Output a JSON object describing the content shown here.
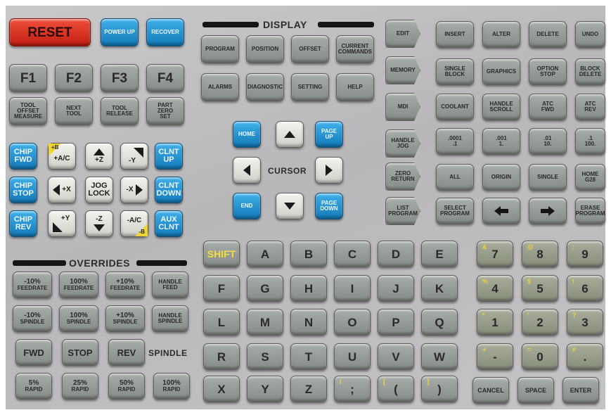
{
  "top_keys": {
    "reset": "RESET",
    "power_up": "POWER UP",
    "recover": "RECOVER"
  },
  "function_keys": [
    "F1",
    "F2",
    "F3",
    "F4"
  ],
  "tool_keys": [
    [
      "TOOL",
      "OFFSET",
      "MEASURE"
    ],
    [
      "NEXT",
      "TOOL"
    ],
    [
      "TOOL",
      "RELEASE"
    ],
    [
      "PART",
      "ZERO",
      "SET"
    ]
  ],
  "jog": {
    "chip_fwd": [
      "CHIP",
      "FWD"
    ],
    "chip_stop": [
      "CHIP",
      "STOP"
    ],
    "chip_rev": [
      "CHIP",
      "REV"
    ],
    "clnt_up": [
      "CLNT",
      "UP"
    ],
    "clnt_down": [
      "CLNT",
      "DOWN"
    ],
    "aux_clnt": [
      "AUX",
      "CLNT"
    ],
    "plus_b": "+B",
    "plus_ac": "+A/C",
    "plus_z": "+Z",
    "minus_y": "-Y",
    "plus_x": "+X",
    "jog_lock": [
      "JOG",
      "LOCK"
    ],
    "minus_x": "-X",
    "plus_y": "+Y",
    "minus_z": "-Z",
    "minus_ac": "-A/C",
    "minus_b": "-B"
  },
  "overrides": {
    "title": "OVERRIDES",
    "feed": [
      [
        "-10%",
        "FEEDRATE"
      ],
      [
        "100%",
        "FEEDRATE"
      ],
      [
        "+10%",
        "FEEDRATE"
      ],
      [
        "HANDLE",
        "FEED"
      ]
    ],
    "spindle": [
      [
        "-10%",
        "SPINDLE"
      ],
      [
        "100%",
        "SPINDLE"
      ],
      [
        "+10%",
        "SPINDLE"
      ],
      [
        "HANDLE",
        "SPINDLE"
      ]
    ],
    "spindle_ctrl": [
      "FWD",
      "STOP",
      "REV"
    ],
    "spindle_label": "SPINDLE",
    "rapid": [
      [
        "5%",
        "RAPID"
      ],
      [
        "25%",
        "RAPID"
      ],
      [
        "50%",
        "RAPID"
      ],
      [
        "100%",
        "RAPID"
      ]
    ]
  },
  "display": {
    "title": "DISPLAY",
    "row1": [
      [
        "PROGRAM"
      ],
      [
        "POSITION"
      ],
      [
        "OFFSET"
      ],
      [
        "CURRENT",
        "COMMANDS"
      ]
    ],
    "row2": [
      [
        "ALARMS"
      ],
      [
        "DIAGNOSTIC"
      ],
      [
        "SETTING"
      ],
      [
        "HELP"
      ]
    ]
  },
  "cursor": {
    "label": "CURSOR",
    "home": "HOME",
    "page_up": [
      "PAGE",
      "UP"
    ],
    "end": "END",
    "page_down": [
      "PAGE",
      "DOWN"
    ]
  },
  "modes": [
    [
      "EDIT"
    ],
    [
      "MEMORY"
    ],
    [
      "MDI"
    ],
    [
      "HANDLE",
      "JOG"
    ],
    [
      "ZERO",
      "RETURN"
    ],
    [
      "LIST",
      "PROGRAM"
    ]
  ],
  "right_keys": [
    [
      [
        "INSERT"
      ],
      [
        "ALTER"
      ],
      [
        "DELETE"
      ],
      [
        "UNDO"
      ]
    ],
    [
      [
        "SINGLE",
        "BLOCK"
      ],
      [
        "GRAPHICS"
      ],
      [
        "OPTION",
        "STOP"
      ],
      [
        "BLOCK",
        "DELETE"
      ]
    ],
    [
      [
        "COOLANT"
      ],
      [
        "HANDLE",
        "SCROLL"
      ],
      [
        "ATC",
        "FWD"
      ],
      [
        "ATC",
        "REV"
      ]
    ],
    [
      [
        ".0001",
        ".1"
      ],
      [
        ".001",
        "1."
      ],
      [
        ".01",
        "10."
      ],
      [
        ".1",
        "100."
      ]
    ],
    [
      [
        "ALL"
      ],
      [
        "ORIGIN"
      ],
      [
        "SINGLE"
      ],
      [
        "HOME",
        "G28"
      ]
    ],
    [
      [
        "SELECT",
        "PROGRAM"
      ],
      [
        "ERASE",
        "PROGRAM"
      ]
    ]
  ],
  "alpha": {
    "shift": "SHIFT",
    "rows": [
      [
        "A",
        "B",
        "C",
        "D",
        "E"
      ],
      [
        "F",
        "G",
        "H",
        "I",
        "J",
        "K"
      ],
      [
        "L",
        "M",
        "N",
        "O",
        "P",
        "Q"
      ],
      [
        "R",
        "S",
        "T",
        "U",
        "V",
        "W"
      ],
      [
        "X",
        "Y",
        "Z",
        ";",
        "(",
        ")"
      ]
    ],
    "shift_alts": [
      "/",
      "[",
      "]"
    ]
  },
  "numeric": {
    "rows": [
      [
        {
          "main": "7",
          "alt": "&"
        },
        {
          "main": "8",
          "alt": "@"
        },
        {
          "main": "9",
          "alt": ":"
        }
      ],
      [
        {
          "main": "4",
          "alt": "%"
        },
        {
          "main": "5",
          "alt": "$"
        },
        {
          "main": "6",
          "alt": "!"
        }
      ],
      [
        {
          "main": "1",
          "alt": "*"
        },
        {
          "main": "2",
          "alt": "'"
        },
        {
          "main": "3",
          "alt": "?"
        }
      ],
      [
        {
          "main": "-",
          "alt": "+"
        },
        {
          "main": "0",
          "alt": "="
        },
        {
          "main": ".",
          "alt": "#"
        }
      ]
    ],
    "bottom": [
      "CANCEL",
      "SPACE",
      "ENTER"
    ]
  },
  "colors": {
    "red": "#d62c1c",
    "blue": "#1f8fd0",
    "gray": "#979c98",
    "white": "#e6e6e0",
    "yellow_legend": "#f2d23a"
  }
}
